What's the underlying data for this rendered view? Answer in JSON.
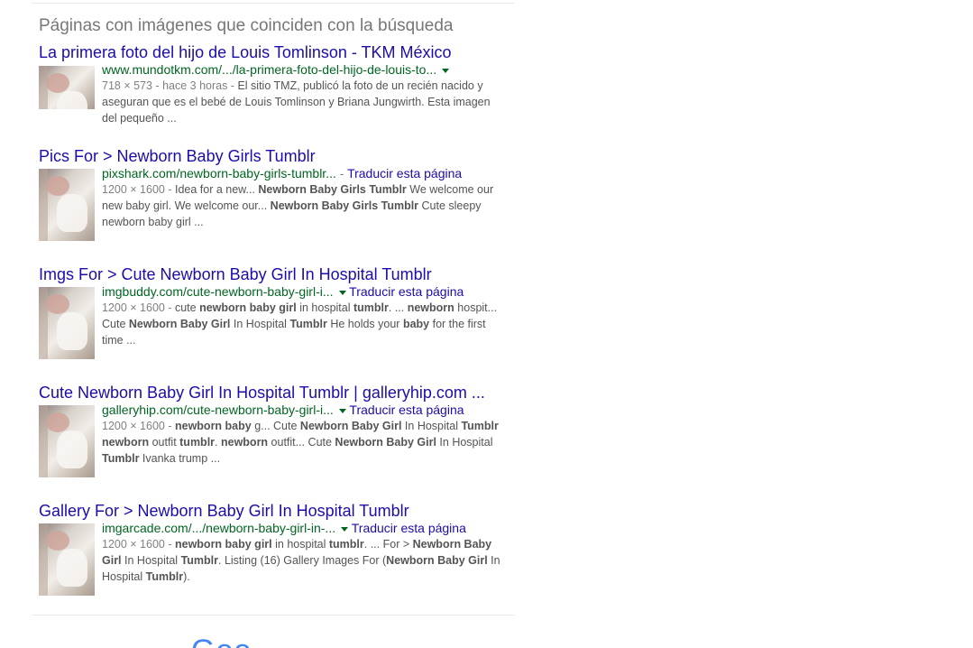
{
  "section": {
    "heading": "Páginas con imágenes que coinciden con la búsqueda"
  },
  "results": [
    {
      "title": "La primera foto del hijo de Louis Tomlinson - TKM México",
      "url": "www.mundotkm.com/.../la-primera-foto-del-hijo-de-louis-to...",
      "has_caret": true,
      "translate": "",
      "meta": "718 × 573 - hace 3 horas - ",
      "snippet_html": "El sitio TMZ, publicó la foto de un recién nacido y aseguran que es el bebé de Louis Tomlinson y Briana Jungwirth. Esta imagen del pequeño ..."
    },
    {
      "title": "Pics For > Newborn Baby Girls Tumblr",
      "url": "pixshark.com/newborn-baby-girls-tumblr...",
      "has_caret": false,
      "translate": "Traducir esta página",
      "meta": "1200 × 1600 - ",
      "snippet_html": "Idea for a new... <b>Newborn Baby Girls Tumblr</b> We welcome our new baby girl. We welcome our... <b>Newborn Baby Girls Tumblr</b> Cute sleepy newborn baby girl ..."
    },
    {
      "title": "Imgs For > Cute Newborn Baby Girl In Hospital Tumblr",
      "url": "imgbuddy.com/cute-newborn-baby-girl-i...",
      "has_caret": true,
      "translate": "Traducir esta página",
      "meta": "1200 × 1600 - ",
      "snippet_html": "cute <b>newborn baby girl</b> in hospital <b>tumblr</b>. ... <b>newborn</b> hospit... Cute <b>Newborn Baby Girl</b> In Hospital <b>Tumblr</b> He holds your <b>baby</b> for the first time ..."
    },
    {
      "title": "Cute Newborn Baby Girl In Hospital Tumblr | galleryhip.com ...",
      "url": "galleryhip.com/cute-newborn-baby-girl-i...",
      "has_caret": true,
      "translate": "Traducir esta página",
      "meta": "1200 × 1600 - ",
      "snippet_html": "<b>newborn baby</b> g... Cute <b>Newborn Baby Girl</b> In Hospital <b>Tumblr newborn</b> outfit <b>tumblr</b>. <b>newborn</b> outfit... Cute <b>Newborn Baby Girl</b> In Hospital <b>Tumblr</b> Ivanka trump ..."
    },
    {
      "title": "Gallery For > Newborn Baby Girl In Hospital Tumblr",
      "url": "imgarcade.com/.../newborn-baby-girl-in-...",
      "has_caret": true,
      "translate": "Traducir esta página",
      "meta": "1200 × 1600 - ",
      "snippet_html": "<b>newborn baby girl</b> in hospital <b>tumblr</b>. ... For > <b>Newborn Baby Girl</b> In Hospital <b>Tumblr</b>. Listing (16) Gallery Images For (<b>Newborn Baby Girl</b> In Hospital <b>Tumblr</b>)."
    }
  ],
  "footer": {
    "logo_text": "Goo"
  },
  "colors": {
    "title_link": "#1a0dab",
    "url_green": "#006621",
    "snippet": "#545454",
    "meta_gray": "#808080",
    "heading_gray": "#777777"
  }
}
